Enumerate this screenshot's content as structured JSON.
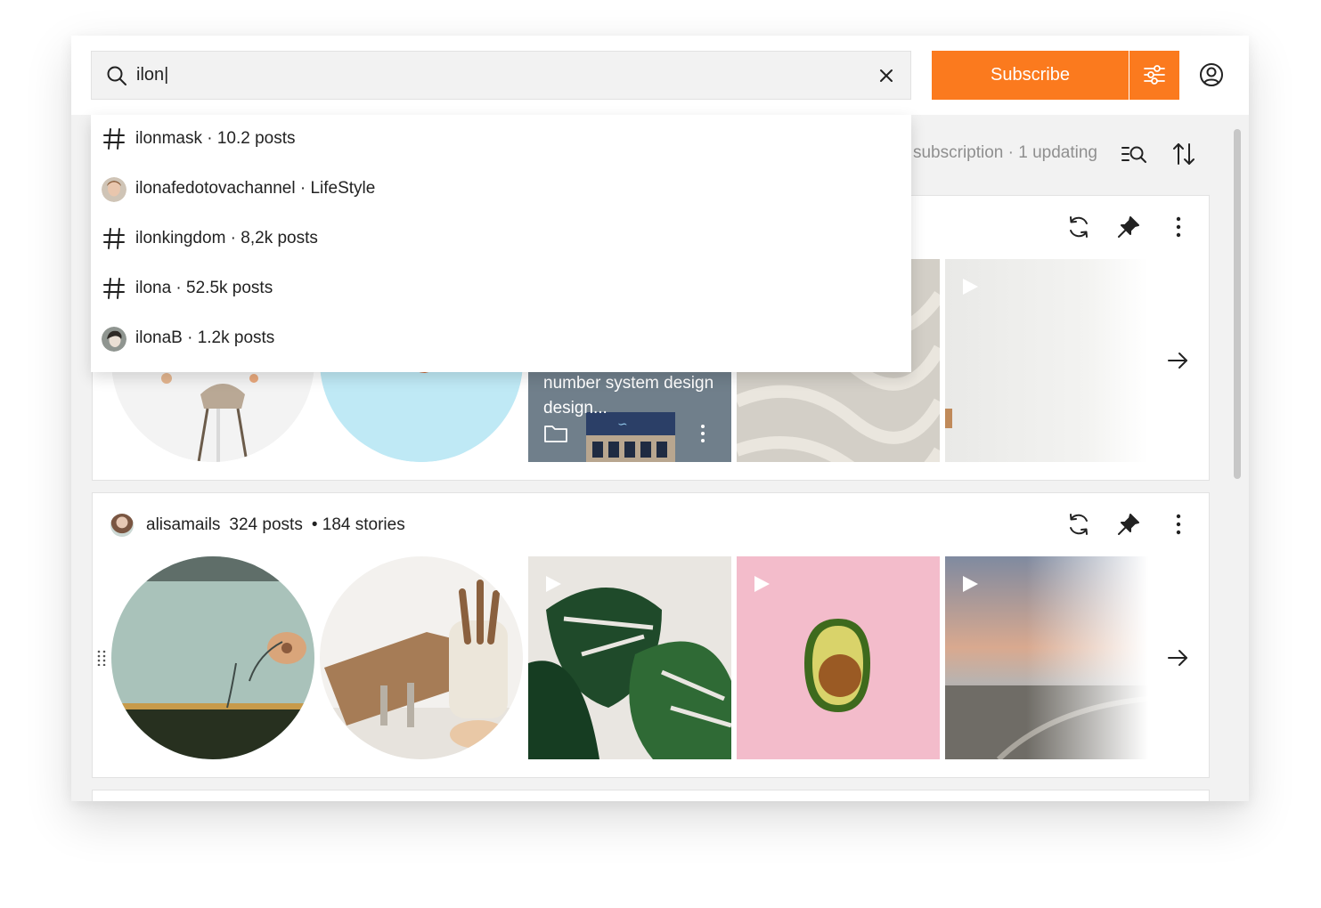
{
  "search": {
    "value": "ilon|",
    "clear_label": "Clear search"
  },
  "header": {
    "subscribe_label": "Subscribe",
    "filter_icon": "sliders-icon",
    "account_icon": "user-circle-icon"
  },
  "suggestions": [
    {
      "type": "hashtag",
      "icon": "hash-icon",
      "label": "ilonmask · 10.2 posts"
    },
    {
      "type": "user",
      "icon": "avatar",
      "label": "ilonafedotovachannel · LifeStyle"
    },
    {
      "type": "hashtag",
      "icon": "hash-icon",
      "label": "ilonkingdom · 8,2k posts"
    },
    {
      "type": "hashtag",
      "icon": "hash-icon",
      "label": "ilona · 52.5k posts"
    },
    {
      "type": "user",
      "icon": "avatar",
      "label": "ilonaB · 1.2k posts"
    }
  ],
  "toolbar": {
    "status": "subscription · 1 updating",
    "search_list_icon": "list-search-icon",
    "sort_icon": "sort-icon"
  },
  "cards": [
    {
      "tile_caption": "number system design design...",
      "icons": [
        "refresh-icon",
        "pin-icon",
        "more-vertical-icon",
        "arrow-right-icon"
      ]
    },
    {
      "username": "alisamails",
      "posts": "324 posts",
      "stories": "• 184 stories",
      "icons": [
        "refresh-icon",
        "pin-icon",
        "more-vertical-icon",
        "arrow-right-icon",
        "drag-handle-icon"
      ]
    }
  ],
  "colors": {
    "accent": "#fb7a1e",
    "background": "#f2f2f2",
    "text": "#1f1f1f",
    "muted": "#8f8f8f"
  }
}
